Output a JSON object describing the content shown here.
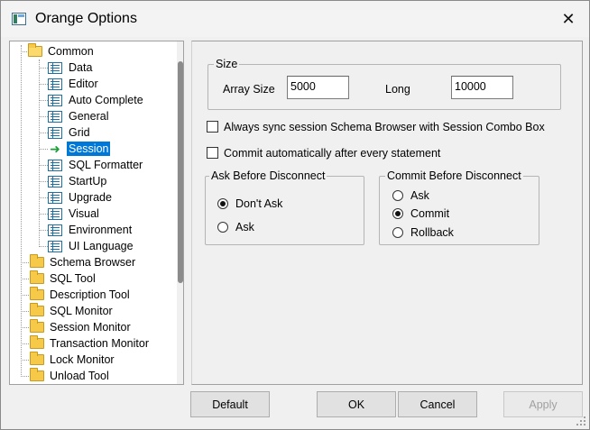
{
  "window": {
    "title": "Orange Options",
    "close_glyph": "✕"
  },
  "tree": {
    "items": [
      {
        "label": "Common",
        "icon": "folder-open-icon"
      },
      {
        "label": "Data",
        "icon": "doc-icon"
      },
      {
        "label": "Editor",
        "icon": "doc-icon"
      },
      {
        "label": "Auto Complete",
        "icon": "doc-icon"
      },
      {
        "label": "General",
        "icon": "doc-icon"
      },
      {
        "label": "Grid",
        "icon": "doc-icon"
      },
      {
        "label": "Session",
        "icon": "arrow-right-icon",
        "selected": true
      },
      {
        "label": "SQL Formatter",
        "icon": "doc-icon"
      },
      {
        "label": "StartUp",
        "icon": "doc-icon"
      },
      {
        "label": "Upgrade",
        "icon": "doc-icon"
      },
      {
        "label": "Visual",
        "icon": "doc-icon"
      },
      {
        "label": "Environment",
        "icon": "doc-icon"
      },
      {
        "label": "UI Language",
        "icon": "doc-icon"
      },
      {
        "label": "Schema Browser",
        "icon": "folder-icon"
      },
      {
        "label": "SQL Tool",
        "icon": "folder-icon"
      },
      {
        "label": "Description Tool",
        "icon": "folder-icon"
      },
      {
        "label": "SQL Monitor",
        "icon": "folder-icon"
      },
      {
        "label": "Session Monitor",
        "icon": "folder-icon"
      },
      {
        "label": "Transaction Monitor",
        "icon": "folder-icon"
      },
      {
        "label": "Lock Monitor",
        "icon": "folder-icon"
      },
      {
        "label": "Unload Tool",
        "icon": "folder-icon"
      }
    ]
  },
  "size_group": {
    "title": "Size",
    "array_size_label": "Array Size",
    "array_size_value": "5000",
    "long_label": "Long",
    "long_value": "10000"
  },
  "options": {
    "always_sync_label": "Always sync session Schema Browser with Session Combo Box",
    "always_sync_checked": false,
    "commit_auto_label": "Commit automatically after every statement",
    "commit_auto_checked": false
  },
  "ask_before_disconnect": {
    "title": "Ask Before Disconnect",
    "options": [
      {
        "label": "Don't Ask",
        "checked": true
      },
      {
        "label": "Ask",
        "checked": false
      }
    ]
  },
  "commit_before_disconnect": {
    "title": "Commit Before Disconnect",
    "options": [
      {
        "label": "Ask",
        "checked": false
      },
      {
        "label": "Commit",
        "checked": true
      },
      {
        "label": "Rollback",
        "checked": false
      }
    ]
  },
  "buttons": {
    "default": "Default",
    "ok": "OK",
    "cancel": "Cancel",
    "apply": "Apply"
  },
  "colors": {
    "selection": "#0078d7",
    "arrow": "#1e9e3a"
  }
}
